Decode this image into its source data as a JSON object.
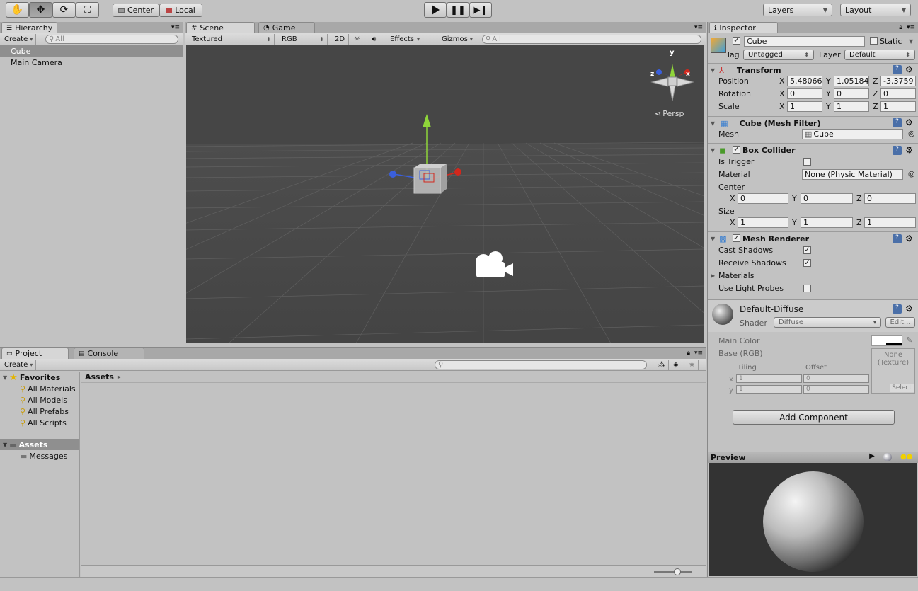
{
  "toolbar": {
    "pivot_center": "Center",
    "pivot_local": "Local",
    "layers": "Layers",
    "layout": "Layout"
  },
  "hierarchy": {
    "tab": "Hierarchy",
    "create": "Create",
    "search_placeholder": "All",
    "items": [
      "Cube",
      "Main Camera"
    ]
  },
  "scene": {
    "tab_scene": "Scene",
    "tab_game": "Game",
    "draw_mode": "Textured",
    "render_mode": "RGB",
    "mode_2d": "2D",
    "effects": "Effects",
    "gizmos": "Gizmos",
    "search_placeholder": "All",
    "persp_label": "Persp",
    "axis_x": "x",
    "axis_y": "y",
    "axis_z": "z"
  },
  "project": {
    "tab_project": "Project",
    "tab_console": "Console",
    "create": "Create",
    "favorites": "Favorites",
    "favorite_items": [
      "All Materials",
      "All Models",
      "All Prefabs",
      "All Scripts"
    ],
    "assets": "Assets",
    "asset_folders": [
      "Messages"
    ],
    "breadcrumb": "Assets"
  },
  "inspector": {
    "tab": "Inspector",
    "object_name": "Cube",
    "static_label": "Static",
    "tag_label": "Tag",
    "tag_value": "Untagged",
    "layer_label": "Layer",
    "layer_value": "Default",
    "transform": {
      "title": "Transform",
      "position_label": "Position",
      "rotation_label": "Rotation",
      "scale_label": "Scale",
      "position": [
        "5.48066",
        "1.05184",
        "-3.3759"
      ],
      "rotation": [
        "0",
        "0",
        "0"
      ],
      "scale": [
        "1",
        "1",
        "1"
      ],
      "x": "X",
      "y": "Y",
      "z": "Z"
    },
    "mesh_filter": {
      "title": "Cube (Mesh Filter)",
      "mesh_label": "Mesh",
      "mesh_value": "Cube"
    },
    "box_collider": {
      "title": "Box Collider",
      "is_trigger": "Is Trigger",
      "material_label": "Material",
      "material_value": "None (Physic Material)",
      "center_label": "Center",
      "center": [
        "0",
        "0",
        "0"
      ],
      "size_label": "Size",
      "size": [
        "1",
        "1",
        "1"
      ]
    },
    "mesh_renderer": {
      "title": "Mesh Renderer",
      "cast_shadows": "Cast Shadows",
      "receive_shadows": "Receive Shadows",
      "materials": "Materials",
      "use_light_probes": "Use Light Probes"
    },
    "material": {
      "name": "Default-Diffuse",
      "shader_label": "Shader",
      "shader_value": "Diffuse",
      "edit": "Edit...",
      "main_color": "Main Color",
      "base_rgb": "Base (RGB)",
      "tiling": "Tiling",
      "offset": "Offset",
      "x": "x",
      "y": "y",
      "tiling_x": "1",
      "tiling_y": "1",
      "offset_x": "0",
      "offset_y": "0",
      "texture_none": "None",
      "texture_type": "(Texture)",
      "select": "Select"
    },
    "add_component": "Add Component",
    "preview": "Preview"
  },
  "colors": {
    "selection": "#8f8f8f",
    "scene_bg": "#464646",
    "axis_x": "#d3281d",
    "axis_y": "#8fd53a",
    "axis_z": "#3a5fdc"
  }
}
